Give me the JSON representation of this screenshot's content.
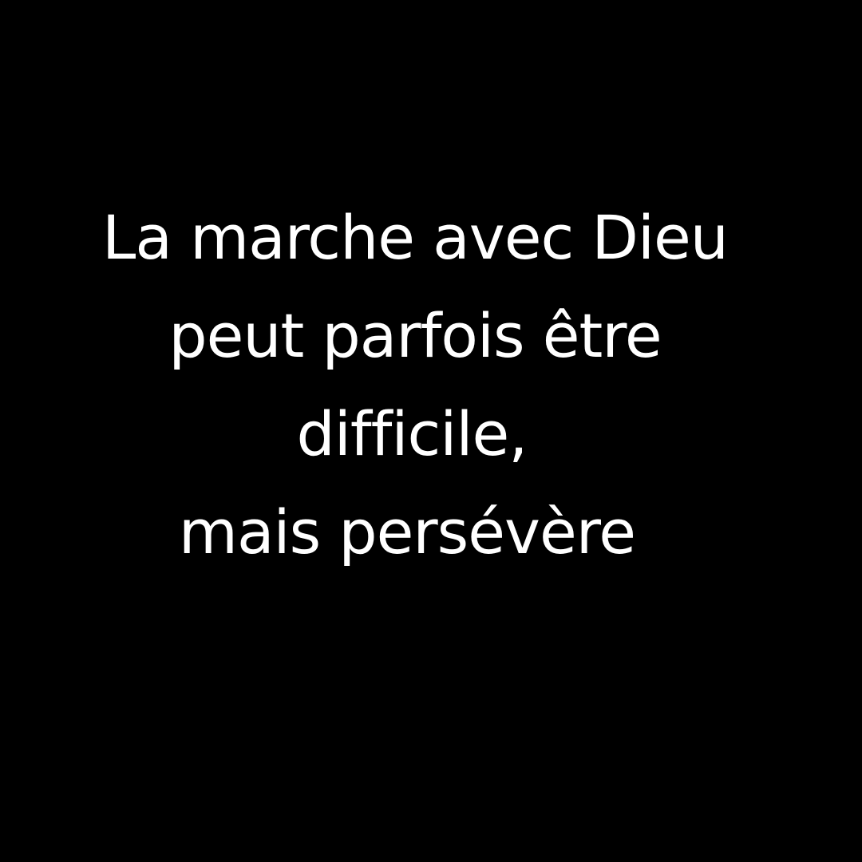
{
  "background_color": "#000000",
  "text_color": "#ffffff",
  "quote": {
    "lines": [
      "La marche avec Dieu",
      "peut parfois être",
      "difficile,",
      "mais persévère"
    ]
  }
}
